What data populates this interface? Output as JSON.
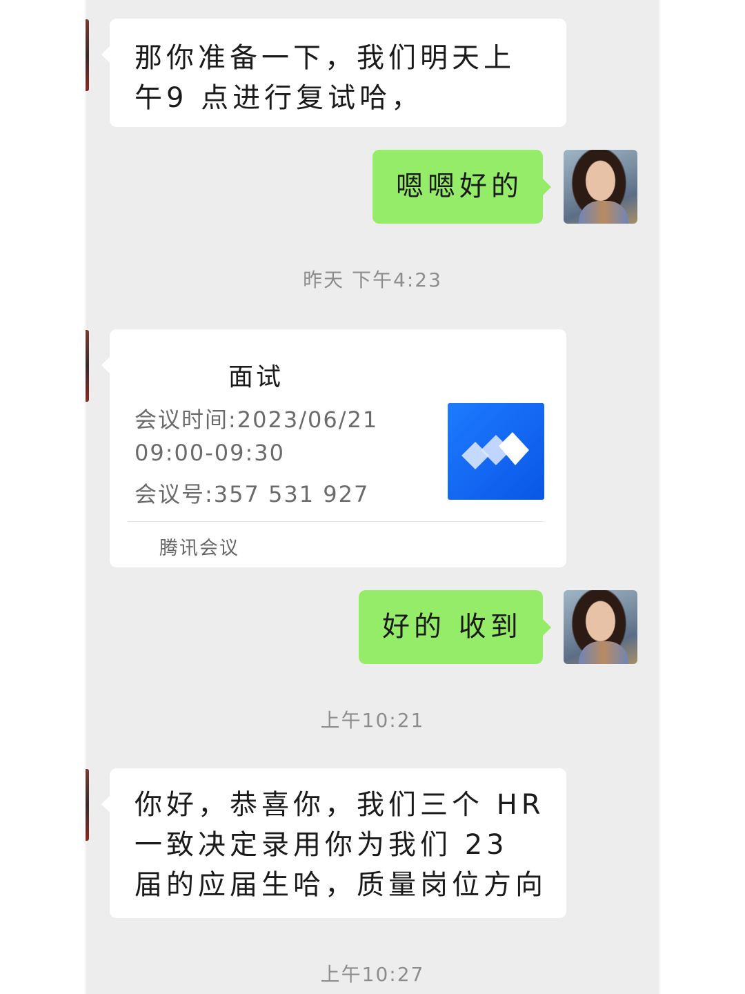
{
  "messages": {
    "m1": "那你准备一下，我们明天上午9 点进行复试哈，",
    "m2": "嗯嗯好的",
    "m3": "好的 收到",
    "m4": "你好，恭喜你，我们三个 HR 一致决定录用你为我们 23 届的应届生哈，质量岗位方向"
  },
  "timestamps": {
    "t1": "昨天 下午4:23",
    "t2": "上午10:21",
    "t3": "上午10:27"
  },
  "meeting_card": {
    "title": "面试",
    "time_line": "会议时间:2023/06/21",
    "time_range": "09:00-09:30",
    "meeting_id": "会议号:357 531 927",
    "source": "腾讯会议"
  },
  "icons": {
    "avatar": "user-avatar-photo",
    "card_icon": "tencent-meeting-logo-icon"
  },
  "colors": {
    "chat_background": "#ededed",
    "incoming_bubble": "#ffffff",
    "outgoing_bubble": "#95ec69",
    "timestamp_text": "#8d8d8d",
    "meeting_logo_blue": "#1d7bff"
  }
}
